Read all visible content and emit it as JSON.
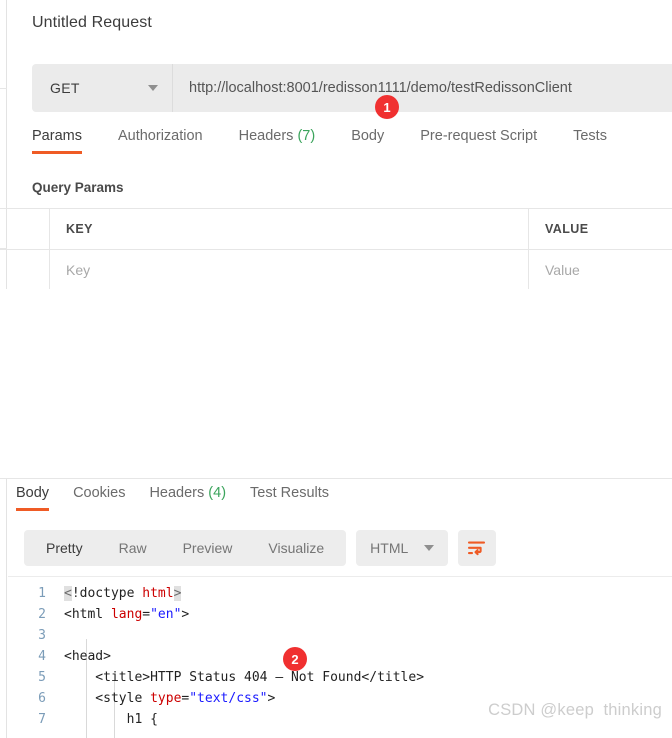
{
  "request": {
    "title": "Untitled Request",
    "method": "GET",
    "url": "http://localhost:8001/redisson1111/demo/testRedissonClient",
    "tabs": [
      {
        "label": "Params",
        "count": "",
        "active": true
      },
      {
        "label": "Authorization",
        "count": "",
        "active": false
      },
      {
        "label": "Headers",
        "count": "(7)",
        "active": false
      },
      {
        "label": "Body",
        "count": "",
        "active": false
      },
      {
        "label": "Pre-request Script",
        "count": "",
        "active": false
      },
      {
        "label": "Tests",
        "count": "",
        "active": false
      }
    ],
    "query_params": {
      "section_label": "Query Params",
      "columns": [
        "KEY",
        "VALUE"
      ],
      "rows": [
        {
          "key_placeholder": "Key",
          "value_placeholder": "Value"
        }
      ]
    }
  },
  "response": {
    "tabs": [
      {
        "label": "Body",
        "count": "",
        "active": true
      },
      {
        "label": "Cookies",
        "count": "",
        "active": false
      },
      {
        "label": "Headers",
        "count": "(4)",
        "active": false
      },
      {
        "label": "Test Results",
        "count": "",
        "active": false
      }
    ],
    "view_modes": [
      {
        "label": "Pretty",
        "active": true
      },
      {
        "label": "Raw",
        "active": false
      },
      {
        "label": "Preview",
        "active": false
      },
      {
        "label": "Visualize",
        "active": false
      }
    ],
    "format": "HTML",
    "wrap_icon": "word-wrap-icon",
    "body_lines": [
      {
        "num": "1",
        "segments": [
          {
            "t": "<",
            "c": "match"
          },
          {
            "t": "!doctype ",
            "c": "tag"
          },
          {
            "t": "html",
            "c": "attr"
          },
          {
            "t": ">",
            "c": "match"
          }
        ]
      },
      {
        "num": "2",
        "segments": [
          {
            "t": "<html ",
            "c": "tag"
          },
          {
            "t": "lang",
            "c": "attr"
          },
          {
            "t": "=",
            "c": "tag"
          },
          {
            "t": "\"en\"",
            "c": "str"
          },
          {
            "t": ">",
            "c": "tag"
          }
        ]
      },
      {
        "num": "3",
        "segments": []
      },
      {
        "num": "4",
        "segments": [
          {
            "t": "<head>",
            "c": "tag"
          }
        ]
      },
      {
        "num": "5",
        "segments": [
          {
            "t": "    <title>HTTP Status 404 – Not Found</title>",
            "c": "tag"
          }
        ]
      },
      {
        "num": "6",
        "segments": [
          {
            "t": "    <style ",
            "c": "tag"
          },
          {
            "t": "type",
            "c": "attr"
          },
          {
            "t": "=",
            "c": "tag"
          },
          {
            "t": "\"text/css\"",
            "c": "str"
          },
          {
            "t": ">",
            "c": "tag"
          }
        ]
      },
      {
        "num": "7",
        "segments": [
          {
            "t": "        h1 {",
            "c": "tag"
          }
        ]
      }
    ]
  },
  "annotations": [
    {
      "id": "1",
      "label": "1"
    },
    {
      "id": "2",
      "label": "2"
    }
  ],
  "watermark": "CSDN @keep  thinking",
  "colors": {
    "accent": "#ef5b25",
    "badge": "#f03030",
    "count_green": "#3ba45c",
    "line_number": "#7b9cb8",
    "control_bg": "#ebebeb"
  }
}
